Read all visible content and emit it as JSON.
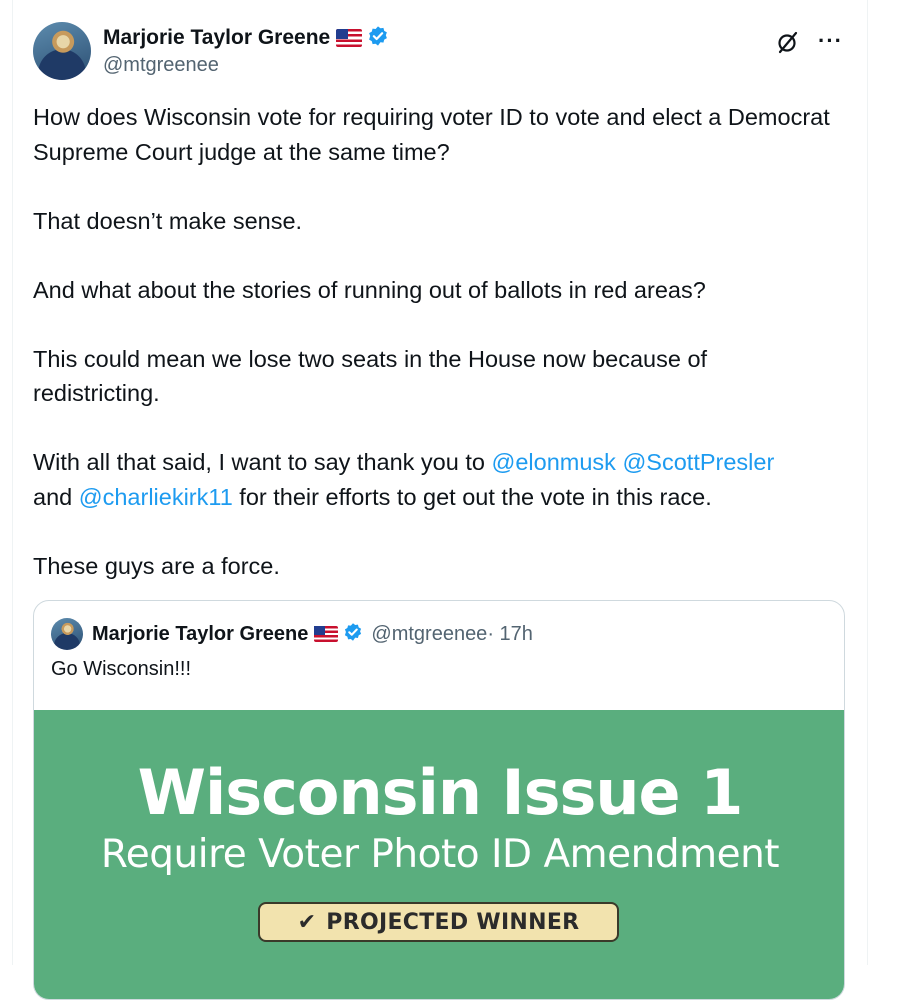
{
  "author": {
    "name": "Marjorie Taylor Greene",
    "handle": "@mtgreenee",
    "flag_icon": "us-flag-icon",
    "verified_icon": "verified-badge-icon",
    "verified_color": "#1d9bf0"
  },
  "toolbar": {
    "grok_icon": "grok-icon",
    "more_label": "···"
  },
  "tweet": {
    "p1": "How does Wisconsin vote for requiring voter ID to vote and elect a Democrat Supreme Court judge at the same time?",
    "p2": "That doesn’t make sense.",
    "p3": "And what about the stories of running out of ballots in red areas?",
    "p4": "This could mean we lose two seats in the House now because of redistricting.",
    "p5_before": "With all that said, I want to say thank you to ",
    "mention1": "@elonmusk",
    "mention2": "@ScottPresler",
    "p5_and": "and ",
    "mention3": "@charliekirk11",
    "p5_after": " for their efforts to get out the vote in this race.",
    "p6": "These guys are a force.",
    "mention_color": "#1d9bf0"
  },
  "quote": {
    "name": "Marjorie Taylor Greene",
    "handle": "@mtgreenee",
    "time": " · 17h",
    "text": "Go Wisconsin!!!",
    "media": {
      "title": "Wisconsin Issue 1",
      "subtitle": "Require Voter Photo ID Amendment",
      "badge_check": "✔",
      "badge_label": "PROJECTED WINNER",
      "background": "#5aae7e",
      "badge_background": "#f2e3ae"
    }
  }
}
